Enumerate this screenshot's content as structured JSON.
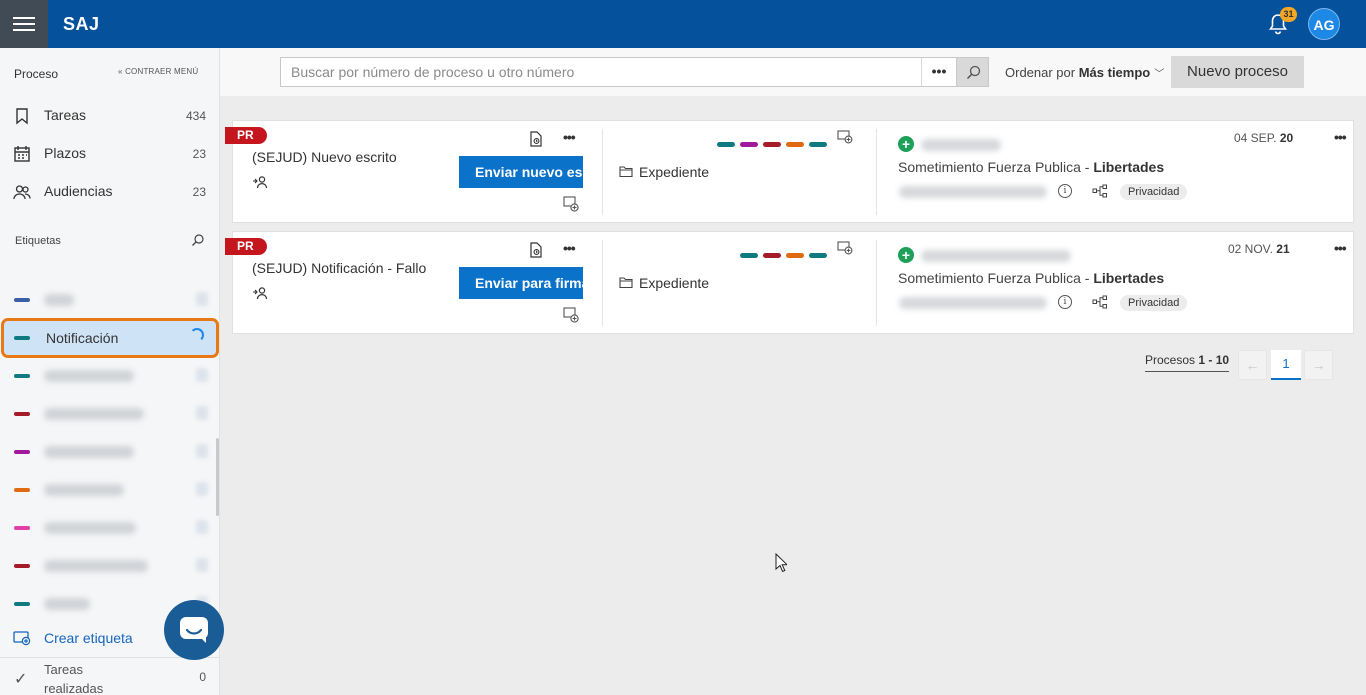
{
  "header": {
    "app_title": "SAJ",
    "notifications_count": "31",
    "avatar_initials": "AG"
  },
  "sidebar": {
    "section_title": "Proceso",
    "collapse_label": "CONTRAER MENÚ",
    "items": [
      {
        "label": "Tareas",
        "count": "434",
        "icon": "bookmark-icon"
      },
      {
        "label": "Plazos",
        "count": "23",
        "icon": "calendar-icon"
      },
      {
        "label": "Audiencias",
        "count": "23",
        "icon": "people-icon"
      }
    ],
    "labels_title": "Etiquetas",
    "tags": [
      {
        "color": "#3a5fa8",
        "label": "",
        "active": false
      },
      {
        "color": "#0f7a80",
        "label": "Notificación",
        "active": true
      },
      {
        "color": "#0f7a80",
        "label": "",
        "active": false
      },
      {
        "color": "#a41c27",
        "label": "",
        "active": false
      },
      {
        "color": "#a01a9c",
        "label": "",
        "active": false
      },
      {
        "color": "#e06a10",
        "label": "",
        "active": false
      },
      {
        "color": "#e040a8",
        "label": "",
        "active": false
      },
      {
        "color": "#a41c27",
        "label": "",
        "active": false
      },
      {
        "color": "#0f7a80",
        "label": "",
        "active": false
      }
    ],
    "create_tag_label": "Crear etiqueta",
    "done_label": "Tareas realizadas",
    "done_count": "0"
  },
  "toolbar": {
    "search_placeholder": "Buscar por número de proceso u otro número",
    "more_label": "•••",
    "order_prefix": "Ordenar por",
    "order_value": "Más tiempo",
    "new_process_label": "Nuevo proceso"
  },
  "cards": [
    {
      "badge": "PR",
      "title": "(SEJUD) Nuevo escrito",
      "action_label": "Enviar nuevo escrito",
      "expediente_label": "Expediente",
      "tag_colors": [
        "#0f7a80",
        "#a01a9c",
        "#a41c27",
        "#e06a10",
        "#0f7a80"
      ],
      "subject_prefix": "Sometimiento Fuerza Publica - ",
      "subject_bold": "Libertades",
      "privacy_label": "Privacidad",
      "date_main": "04 SEP. ",
      "date_bold": "20"
    },
    {
      "badge": "PR",
      "title": "(SEJUD) Notificación - Fallo",
      "action_label": "Enviar para firma",
      "expediente_label": "Expediente",
      "tag_colors": [
        "#0f7a80",
        "#a41c27",
        "#e06a10",
        "#0f7a80"
      ],
      "subject_prefix": "Sometimiento Fuerza Publica - ",
      "subject_bold": "Libertades",
      "privacy_label": "Privacidad",
      "date_main": "02 NOV. ",
      "date_bold": "21"
    }
  ],
  "pager": {
    "label_prefix": "Procesos ",
    "range": "1 - 10",
    "current_page": "1",
    "prev_symbol": "←",
    "next_symbol": "→"
  }
}
